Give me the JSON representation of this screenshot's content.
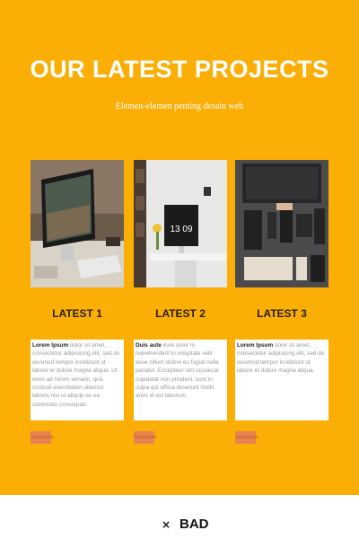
{
  "header": {
    "title": "OUR LATEST PROJECTS",
    "subtitle": "Elemen-elemen penting desain web"
  },
  "colors": {
    "background": "#fbaf06",
    "readmore_button": "#e8834f"
  },
  "projects": [
    {
      "label": "LATEST 1",
      "image_icon": "desk-monitor-image",
      "bold": "Lorem Ipsum",
      "text": " dolor sit amet, consectetur adipisicing elit, sed do eiusmod tempor incididunt ut labore et dolore magna aliqua. Ut enim ad minim veniam, quis nostrud exercitation ullamco laboris nisi ut aliquip ex ea commodo consequat.",
      "button": "READMORE"
    },
    {
      "label": "LATEST 2",
      "image_icon": "workspace-clock-image",
      "bold": "Duis aute",
      "text": " irure dolor in reprehenderit in voluptate velit esse cillum dolore eu fugiat nulla pariatur. Excepteur sint occaecat cupidatat non proident, sunt in culpa qui officia deserunt mollit anim id est laborum.",
      "button": "READMORE"
    },
    {
      "label": "LATEST 3",
      "image_icon": "flatlay-desk-image",
      "bold": "Lorem Ipsum",
      "text": " dolor sit amet, consectetur adipisicing elit, sed do eiusmod tempor incididunt ut labore et dolore magna aliqua.",
      "button": "READMORE"
    }
  ],
  "clock_text": "13 09",
  "footer": {
    "close_glyph": "×",
    "verdict": "BAD"
  }
}
